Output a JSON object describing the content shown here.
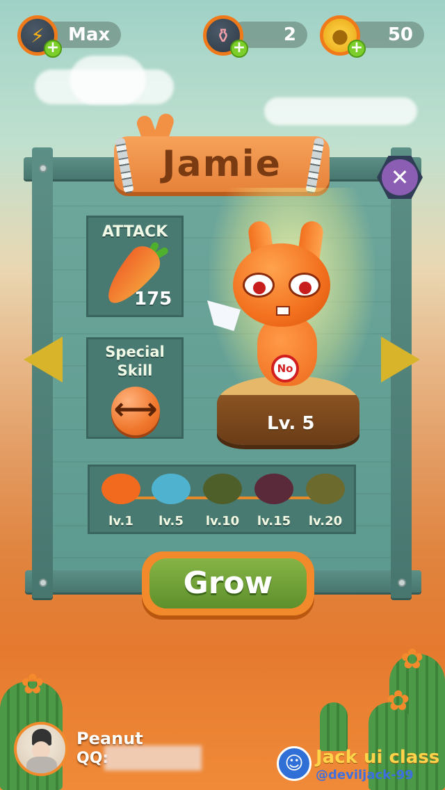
{
  "resources": {
    "energy": {
      "value": "Max",
      "icon": "lightning-icon"
    },
    "potion": {
      "value": "2",
      "icon": "potion-bottle-icon"
    },
    "coins": {
      "value": "50",
      "icon": "coin-icon"
    }
  },
  "character": {
    "name": "Jamie",
    "level_text": "Lv. 5",
    "badge_text": "No"
  },
  "stats": {
    "attack_title": "ATTACK",
    "attack_value": "175",
    "special_title_line1": "Special",
    "special_title_line2": "Skill",
    "special_icon": "double-arrow-icon"
  },
  "evolution": [
    {
      "label": "lv.1",
      "color": "#f26a1e"
    },
    {
      "label": "lv.5",
      "color": "#4fb3cf"
    },
    {
      "label": "lv.10",
      "color": "#4e5f2a"
    },
    {
      "label": "lv.15",
      "color": "#5b2a3a"
    },
    {
      "label": "lv.20",
      "color": "#6c6a2c"
    }
  ],
  "buttons": {
    "grow": "Grow",
    "close": "✕"
  },
  "player": {
    "name": "Peanut",
    "qq": "QQ:"
  },
  "watermark": {
    "title": "Jack ui class",
    "handle": "@deviljack-99"
  },
  "colors": {
    "accent_orange": "#f28a2c",
    "board_green": "#5d9a8f",
    "grow_green": "#6fa136",
    "close_purple": "#8b5db3"
  }
}
